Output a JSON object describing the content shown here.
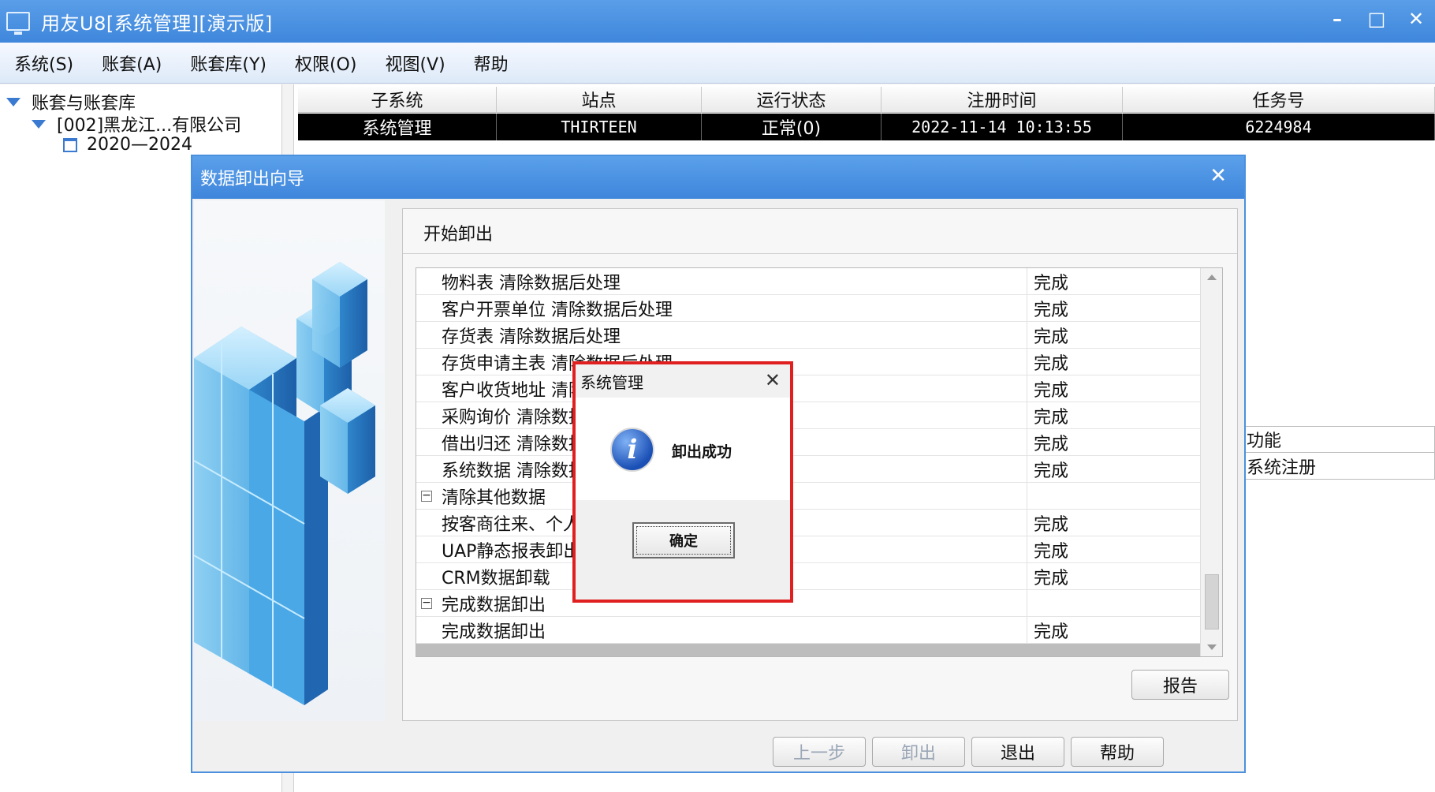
{
  "window": {
    "title": "用友U8[系统管理][演示版]",
    "controls": [
      "–",
      "□",
      "✕"
    ]
  },
  "menu": [
    "系统(S)",
    "账套(A)",
    "账套库(Y)",
    "权限(O)",
    "视图(V)",
    "帮助"
  ],
  "tree": {
    "root": "账套与账套库",
    "account": "[002]黑龙江...有限公司",
    "year": "2020—2024"
  },
  "task_grid": {
    "columns": [
      "子系统",
      "站点",
      "运行状态",
      "注册时间",
      "任务号"
    ],
    "rows": [
      [
        "系统管理",
        "THIRTEEN",
        "正常(0)",
        "2022-11-14 10:13:55",
        "6224984"
      ]
    ]
  },
  "side_list": [
    "功能",
    "系统注册"
  ],
  "wizard": {
    "title": "数据卸出向导",
    "close": "✕",
    "heading": "开始卸出",
    "log_rows": [
      {
        "text": "物料表 清除数据后处理",
        "status": "完成"
      },
      {
        "text": "客户开票单位 清除数据后处理",
        "status": "完成"
      },
      {
        "text": "存货表 清除数据后处理",
        "status": "完成"
      },
      {
        "text": "存货申请主表 清除数据后处理",
        "status": "完成"
      },
      {
        "text": "客户收货地址 清除数据后处理",
        "status": "完成"
      },
      {
        "text": "采购询价 清除数据后处理",
        "status": "完成"
      },
      {
        "text": "借出归还 清除数据后处理",
        "status": "完成"
      },
      {
        "text": "系统数据 清除数据后处理",
        "status": "完成"
      },
      {
        "text": "清除其他数据",
        "status": "",
        "group": true
      },
      {
        "text": "按客商往来、个人往来清除",
        "status": "完成"
      },
      {
        "text": "UAP静态报表卸出",
        "status": "完成"
      },
      {
        "text": "CRM数据卸载",
        "status": "完成"
      },
      {
        "text": "完成数据卸出",
        "status": "",
        "group": true
      },
      {
        "text": "完成数据卸出",
        "status": "完成"
      }
    ],
    "buttons": {
      "report": "报告",
      "prev": "上一步",
      "unload": "卸出",
      "exit": "退出",
      "help": "帮助"
    }
  },
  "message_box": {
    "title": "系统管理",
    "text": "卸出成功",
    "ok": "确定",
    "icon": "info-icon"
  }
}
